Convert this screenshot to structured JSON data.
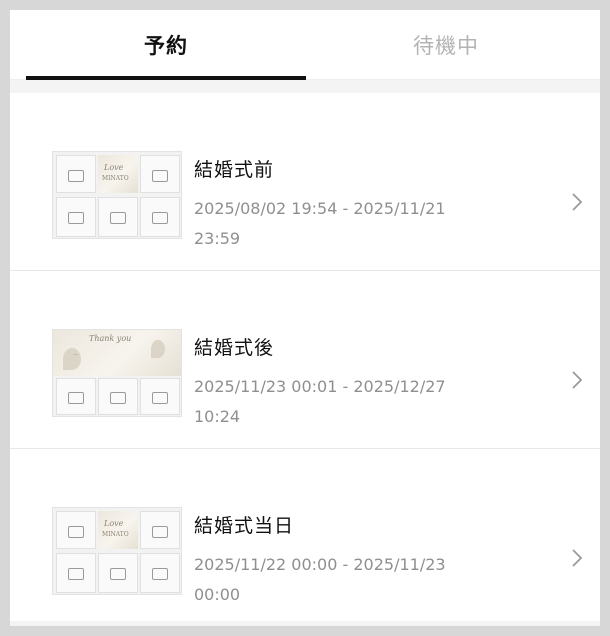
{
  "tabs": [
    {
      "label": "予約",
      "active": true
    },
    {
      "label": "待機中",
      "active": false
    }
  ],
  "items": [
    {
      "title": "結婚式前",
      "period": "2025/08/02 19:54 - 2025/11/21 23:59"
    },
    {
      "title": "結婚式後",
      "period": "2025/11/23 00:01 - 2025/12/27 10:24"
    },
    {
      "title": "結婚式当日",
      "period": "2025/11/22 00:00 - 2025/11/23 00:00"
    }
  ],
  "icons": {
    "row_chevron": "chevron-right-icon"
  },
  "colors": {
    "active_tab": "#111111",
    "inactive_tab": "#b3b3b3",
    "period_text": "#8f8f8f",
    "underline": "#111111"
  }
}
